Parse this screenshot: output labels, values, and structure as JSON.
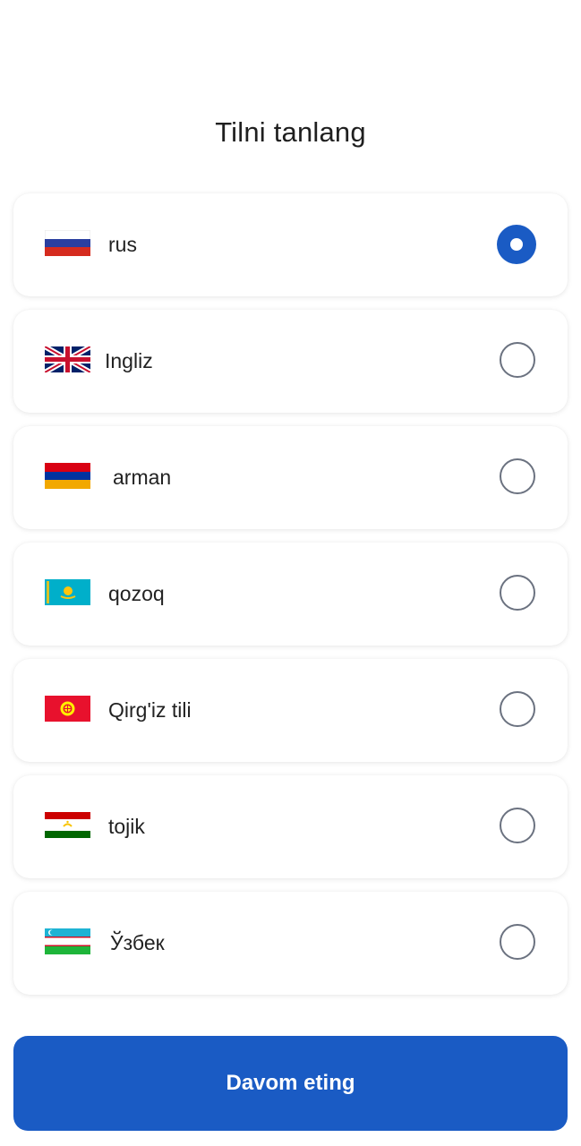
{
  "screen": {
    "title": "Tilni tanlang"
  },
  "languages": [
    {
      "label": "rus",
      "flag": "russia-flag",
      "selected": true
    },
    {
      "label": "Ingliz",
      "flag": "uk-flag",
      "selected": false
    },
    {
      "label": "arman",
      "flag": "armenia-flag",
      "selected": false
    },
    {
      "label": "qozoq",
      "flag": "kazakhstan-flag",
      "selected": false
    },
    {
      "label": "Qirg'iz tili",
      "flag": "kyrgyzstan-flag",
      "selected": false
    },
    {
      "label": "tojik",
      "flag": "tajikistan-flag",
      "selected": false
    },
    {
      "label": "Ўзбек",
      "flag": "uzbekistan-flag",
      "selected": false
    }
  ],
  "actions": {
    "continue_label": "Davom eting"
  },
  "colors": {
    "accent": "#1a5bc4",
    "radio_border": "#6b7280"
  }
}
